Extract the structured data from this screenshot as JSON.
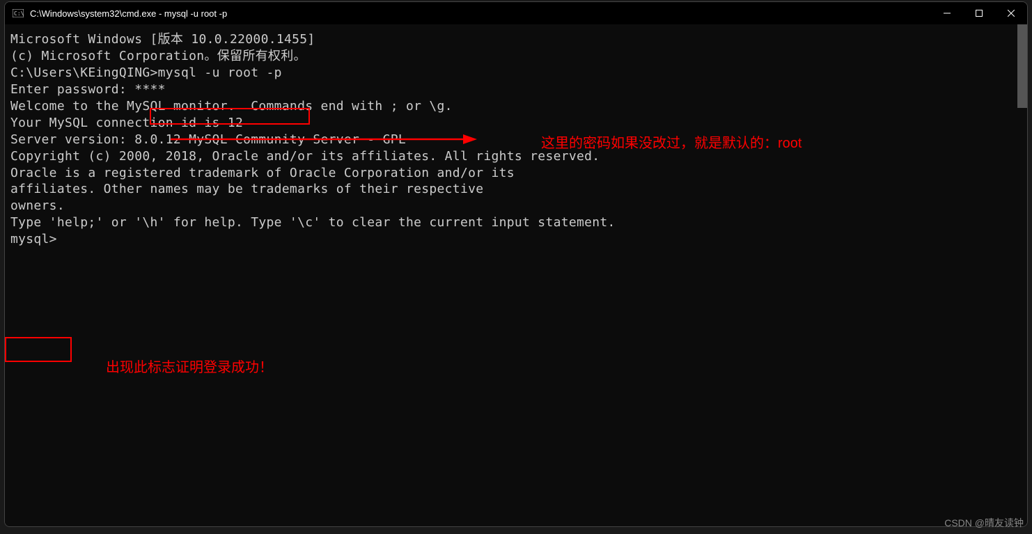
{
  "titlebar": {
    "title": "C:\\Windows\\system32\\cmd.exe - mysql  -u root -p"
  },
  "terminal": {
    "line1": "Microsoft Windows [版本 10.0.22000.1455]",
    "line2": "(c) Microsoft Corporation。保留所有权利。",
    "line3": "",
    "line4_prefix": "C:\\Users\\KEingQING>",
    "line4_cmd": "mysql -u root -p",
    "line5": "Enter password: ****",
    "line6": "Welcome to the MySQL monitor.  Commands end with ; or \\g.",
    "line7": "Your MySQL connection id is 12",
    "line8": "Server version: 8.0.12 MySQL Community Server - GPL",
    "line9": "",
    "line10": "Copyright (c) 2000, 2018, Oracle and/or its affiliates. All rights reserved.",
    "line11": "",
    "line12": "Oracle is a registered trademark of Oracle Corporation and/or its",
    "line13": "affiliates. Other names may be trademarks of their respective",
    "line14": "owners.",
    "line15": "",
    "line16": "Type 'help;' or '\\h' for help. Type '\\c' to clear the current input statement.",
    "line17": "",
    "line18": "mysql> "
  },
  "annotations": {
    "password_hint": "这里的密码如果没改过，就是默认的：root",
    "success_hint": "出现此标志证明登录成功！"
  },
  "watermark": "CSDN @晴友读钟"
}
